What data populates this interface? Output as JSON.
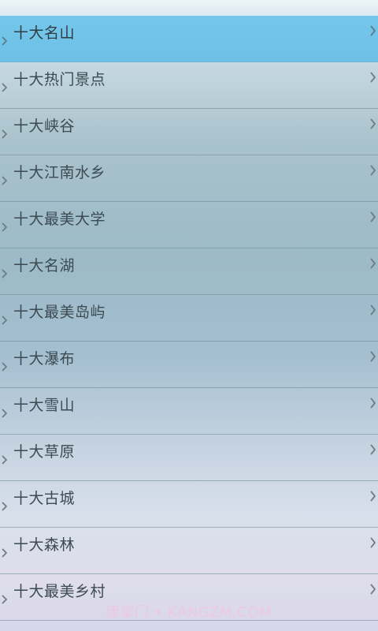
{
  "list": {
    "items": [
      {
        "label": "十大名山",
        "selected": true
      },
      {
        "label": "十大热门景点",
        "selected": false
      },
      {
        "label": "十大峡谷",
        "selected": false
      },
      {
        "label": "十大江南水乡",
        "selected": false
      },
      {
        "label": "十大最美大学",
        "selected": false
      },
      {
        "label": "十大名湖",
        "selected": false
      },
      {
        "label": "十大最美岛屿",
        "selected": false
      },
      {
        "label": "十大瀑布",
        "selected": false
      },
      {
        "label": "十大雪山",
        "selected": false
      },
      {
        "label": "十大草原",
        "selected": false
      },
      {
        "label": "十大古城",
        "selected": false
      },
      {
        "label": "十大森林",
        "selected": false
      },
      {
        "label": "十大最美乡村",
        "selected": false
      }
    ]
  },
  "watermark": {
    "text": "康掌门 • KANGZM.COM"
  },
  "colors": {
    "selected_row": "#74c6ea",
    "text": "#3c4a52",
    "chevron": "#707c84",
    "watermark": "#ecc8e2"
  },
  "icons": {
    "left": "chevron-right-icon",
    "right": "chevron-right-icon"
  }
}
